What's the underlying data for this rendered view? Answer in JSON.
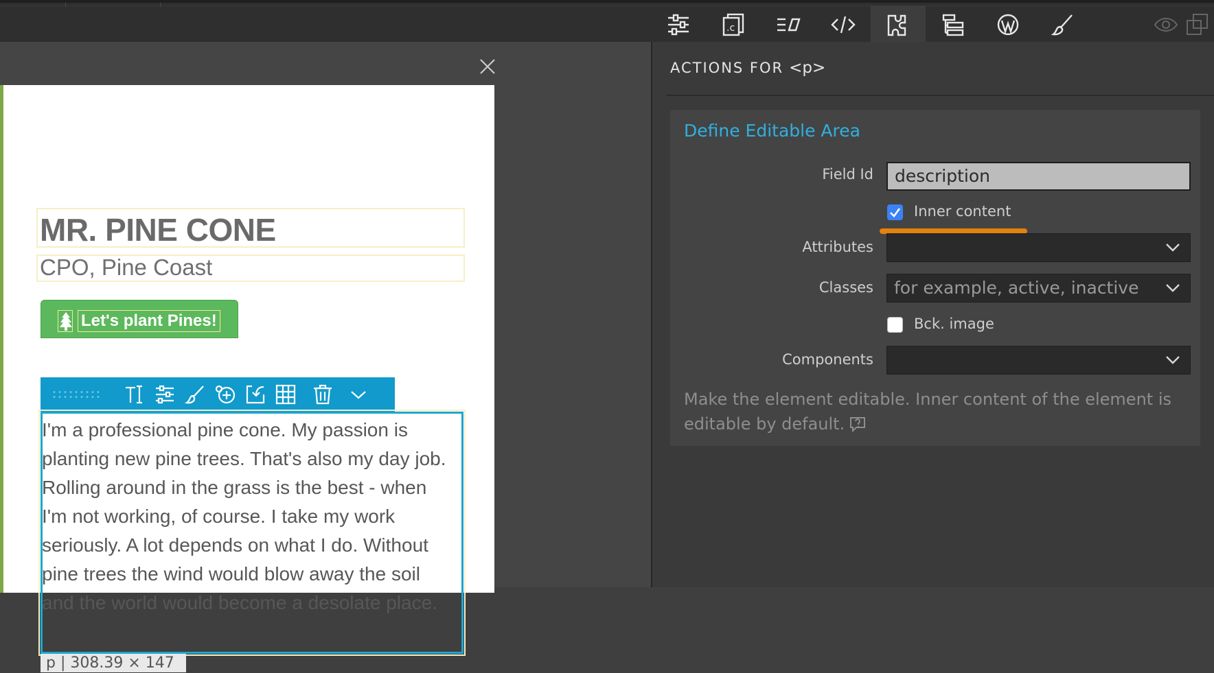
{
  "toolbar": {
    "icons": [
      "sliders-icon",
      "css-file-icon",
      "format-icon",
      "code-icon",
      "puzzle-icon",
      "tree-icon",
      "wordpress-icon",
      "brush-icon",
      "eye-icon",
      "window-icon"
    ],
    "active": "puzzle-icon"
  },
  "canvas": {
    "title": "MR. PINE CONE",
    "subtitle": "CPO, Pine Coast",
    "button_label": "Let's plant Pines!",
    "paragraph": "I'm a professional pine cone. My passion is\nplanting new pine trees. That's also my day job.\nRolling around in the grass is the best - when\nI'm not working, of course. I take my work\nseriously. A lot depends on what I do. Without\npine trees the wind would blow away the soil\nand the world would become a desolate place.",
    "size_badge": "p | 308.39 × 147"
  },
  "panel": {
    "title": "ACTIONS FOR",
    "tag": "<p>",
    "section_title": "Define Editable Area",
    "field_id_label": "Field Id",
    "field_id_value": "description",
    "inner_content_label": "Inner content",
    "inner_content_checked": true,
    "attributes_label": "Attributes",
    "classes_label": "Classes",
    "classes_placeholder": "for example, active, inactive",
    "bck_image_label": "Bck. image",
    "bck_image_checked": false,
    "components_label": "Components",
    "help_text": "Make the element editable. Inner content of the element is editable by default."
  },
  "colors": {
    "accent": "#2fb0e0",
    "highlight": "#e3830e",
    "button_green": "#5cb85c",
    "element_toolbar": "#119acb"
  }
}
